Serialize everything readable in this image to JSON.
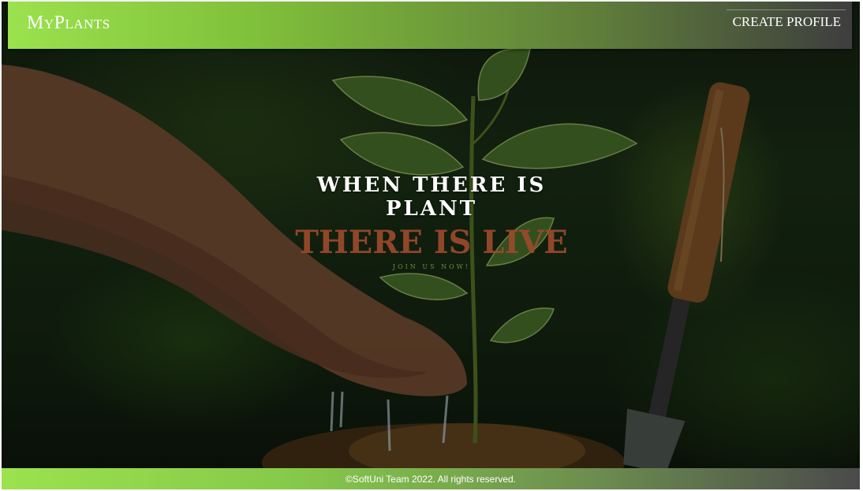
{
  "navbar": {
    "logo": "MyPlants",
    "create_profile": "CREATE PROFILE"
  },
  "hero": {
    "headline": "WHEN THERE IS PLANT",
    "subheadline": "THERE IS LIVE",
    "join_link": "JOIN US NOW!",
    "image_description_icon": "plant-watering-photo"
  },
  "footer": {
    "copyright": "©SoftUni Team 2022. All rights reserved."
  },
  "colors": {
    "navbar_start": "#9be24e",
    "navbar_end": "#3e3e3e",
    "subheadline": "#9c4a2c",
    "background_dark": "#172a14"
  }
}
